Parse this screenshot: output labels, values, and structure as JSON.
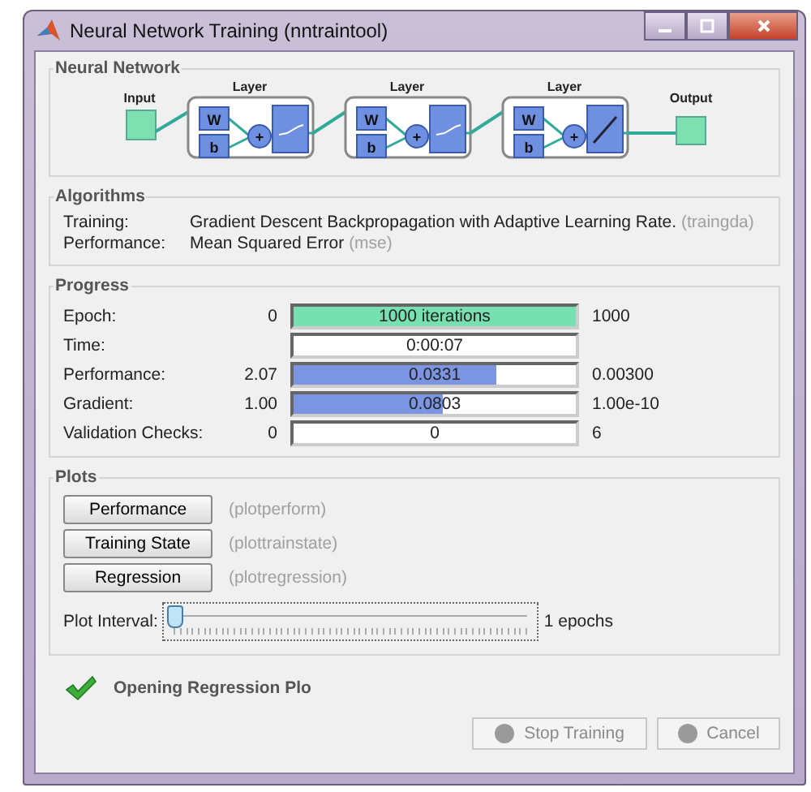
{
  "window": {
    "title": "Neural Network Training (nntraintool)"
  },
  "network": {
    "title": "Neural Network",
    "input": "Input",
    "output": "Output",
    "layers": [
      {
        "label": "Layer",
        "weight": "W",
        "bias": "b",
        "sum": "+",
        "kind": "sigmoid"
      },
      {
        "label": "Layer",
        "weight": "W",
        "bias": "b",
        "sum": "+",
        "kind": "sigmoid"
      },
      {
        "label": "Layer",
        "weight": "W",
        "bias": "b",
        "sum": "+",
        "kind": "linear"
      }
    ]
  },
  "algorithms": {
    "title": "Algorithms",
    "rows": [
      {
        "label": "Training:",
        "value": "Gradient Descent Backpropagation with Adaptive Learning Rate.",
        "code": "(traingda)"
      },
      {
        "label": "Performance:",
        "value": "Mean Squared Error",
        "code": "(mse)"
      }
    ]
  },
  "progress": {
    "title": "Progress",
    "rows": [
      {
        "label": "Epoch:",
        "start": "0",
        "reading": "1000 iterations",
        "end": "1000",
        "level": 1,
        "color": "#76e0b0"
      },
      {
        "label": "Time:",
        "reading": "0:00:07"
      },
      {
        "label": "Performance:",
        "start": "2.07",
        "reading": "0.0331",
        "end": "0.00300",
        "level": 0.72,
        "color": "#7b95e3"
      },
      {
        "label": "Gradient:",
        "start": "1.00",
        "reading": "0.0803",
        "end": "1.00e-10",
        "level": 0.53,
        "color": "#7b95e3"
      },
      {
        "label": "Validation Checks:",
        "start": "0",
        "reading": "0",
        "end": "6"
      }
    ]
  },
  "plots": {
    "title": "Plots",
    "buttons": [
      {
        "label": "Performance",
        "hint": "(plotperform)"
      },
      {
        "label": "Training State",
        "hint": "(plottrainstate)"
      },
      {
        "label": "Regression",
        "hint": "(plotregression)"
      }
    ],
    "interval": {
      "label": "Plot Interval:",
      "level": 0,
      "reading": "1 epochs"
    }
  },
  "status": {
    "kind": "success",
    "text": "Opening Regression Plo"
  },
  "actions": [
    {
      "label": "Stop Training",
      "disabled": true
    },
    {
      "label": "Cancel",
      "disabled": true
    }
  ]
}
